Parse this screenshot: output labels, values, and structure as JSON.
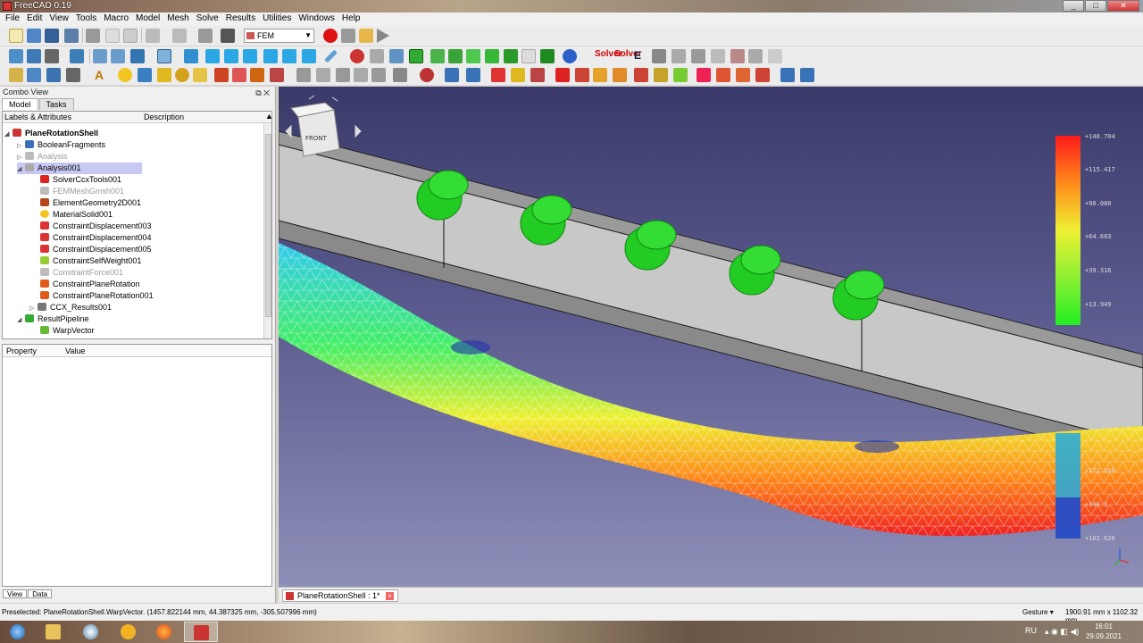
{
  "window": {
    "title": "FreeCAD 0.19"
  },
  "menu": [
    "File",
    "Edit",
    "View",
    "Tools",
    "Macro",
    "Model",
    "Mesh",
    "Solve",
    "Results",
    "Utilities",
    "Windows",
    "Help"
  ],
  "toolbar": {
    "workbench": "FEM",
    "solver_label_1": "Solver",
    "solver_label_2": "Solver",
    "e_label": "E",
    "text_tool": "A"
  },
  "combo": {
    "title": "Combo View",
    "tabs": [
      "Model",
      "Tasks"
    ],
    "tree_columns": [
      "Labels & Attributes",
      "Description"
    ],
    "tree": [
      "PlaneRotationShell",
      "BooleanFragments",
      "Analysis",
      "Analysis001",
      "SolverCcxTools001",
      "FEMMeshGmsh001",
      "ElementGeometry2D001",
      "MaterialSolid001",
      "ConstraintDisplacement003",
      "ConstraintDisplacement004",
      "ConstraintDisplacement005",
      "ConstraintSelfWeight001",
      "ConstraintForce001",
      "ConstraintPlaneRotation",
      "ConstraintPlaneRotation001",
      "CCX_Results001",
      "ResultPipeline",
      "WarpVector"
    ],
    "prop_columns": [
      "Property",
      "Value"
    ],
    "bottom_tabs": [
      "View",
      "Data"
    ]
  },
  "view3d": {
    "navcube_face": "FRONT",
    "legend": {
      "labels": [
        "+140.704",
        "+115.417",
        "+90.080",
        "+64.603",
        "+39.316",
        "+13.949"
      ],
      "lower_labels": [
        "+172.166",
        "+146.1",
        "+102.620"
      ],
      "colors": [
        "#ff0000",
        "#ff8000",
        "#ffff00",
        "#80ff00",
        "#00ff00"
      ]
    },
    "colors": {
      "support_green": "#22cc22",
      "beam_grey": "#c8c8c8"
    }
  },
  "document_tab": {
    "label": "PlaneRotationShell : 1*",
    "close": "×"
  },
  "status": {
    "message": "Preselected: PlaneRotationShell.WarpVector. (1457.822144 mm, 44.387325 mm, -305.507996 mm)",
    "navigation": "Gesture",
    "dimensions": "1900.91 mm x 1102.32 mm"
  },
  "taskbar": {
    "lang": "RU",
    "time": "16:01",
    "date": "29.09.2021"
  }
}
